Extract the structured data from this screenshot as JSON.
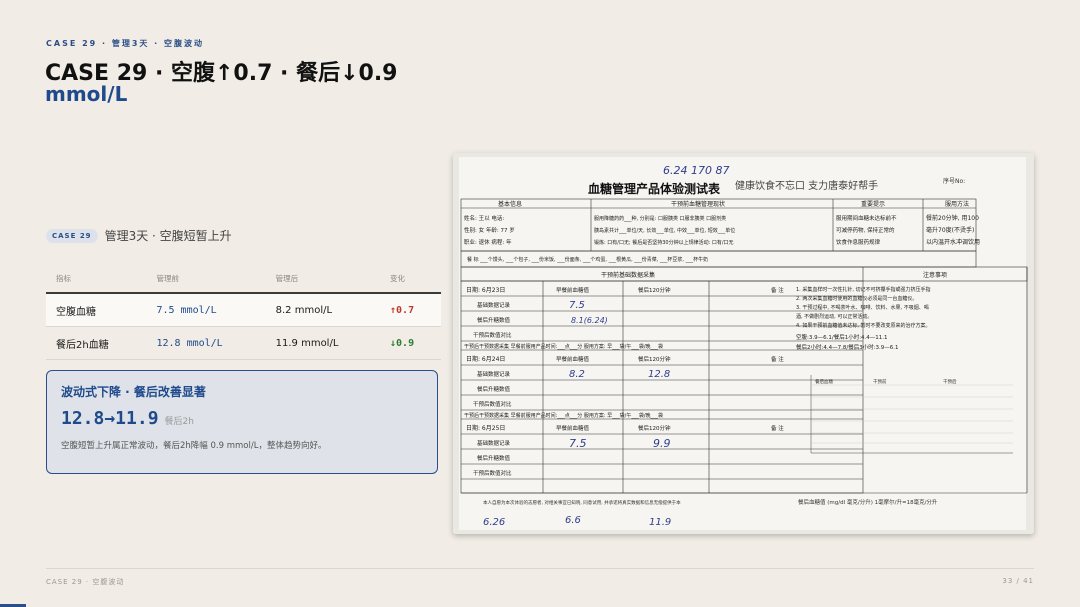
{
  "header": {
    "kicker": "CASE 29 · 管理3天 · 空腹波动",
    "title_line1": "CASE 29 · 空腹↑0.7 · 餐后↓0.9",
    "title_line2": "mmol/L"
  },
  "case_tag": {
    "badge": "CASE 29",
    "subtitle": "管理3天 · 空腹短暂上升"
  },
  "table": {
    "headers": [
      "指标",
      "管理前",
      "管理后",
      "变化"
    ],
    "rows": [
      {
        "metric": "空腹血糖",
        "before": "7.5 mmol/L",
        "after": "8.2 mmol/L",
        "change": "↑0.7"
      },
      {
        "metric": "餐后2h血糖",
        "before": "12.8 mmol/L",
        "after": "11.9 mmol/L",
        "change": "↓0.9"
      }
    ]
  },
  "callout": {
    "heading": "波动式下降 · 餐后改善显著",
    "big_value": "12.8→11.9",
    "big_note": "餐后2h",
    "description": "空腹短暂上升属正常波动，餐后2h降幅 0.9 mmol/L，整体趋势向好。"
  },
  "form": {
    "top_note": "6.24   170   87",
    "title": "血糖管理产品体验测试表",
    "slogan": "健康饮食不忘口 支力唐泰好帮手",
    "serial": "序号No:",
    "col_basic": "基本信息",
    "col_status": "干预前血糖管理现状",
    "col_tips": "重要提示",
    "col_usage": "服用方法",
    "basic_lines": [
      "姓名: 王以   电话:",
      "性别: 女    年龄: 77 岁",
      "职业: 退休    病程:      年"
    ],
    "status_lines": [
      "服用降糖药药___种, 分别是: 口服胰类 口服非胰类 口服剂类",
      "胰岛素共计___单位/天, 长效___单位, 中效___单位, 短效___单位",
      "锻炼: 口有/口无; 餐后是否坚持30分钟以上规律活动: 口有/口无"
    ],
    "tips_lines": [
      "服用期间血糖未达标前不",
      "可减停药物, 保持正常的",
      "饮食作息服药规律"
    ],
    "usage_lines": [
      "餐前20分钟, 用100",
      "毫升70度(不烫手)",
      "以内温开水冲调饮用"
    ],
    "meal_row": "餐  标   ___个馒头, ___个包子, ___份米饭, ___份面条, ___个鸡蛋, ___根黄瓜, ___份青菜, ___杯豆浆, ___杯牛奶",
    "section_baseline": "干预前基础数据采集",
    "section_notes": "注意事项",
    "day1_date": "日期: 6月23日",
    "col_fasting": "早餐前血糖值",
    "col_post": "餐后120分钟",
    "col_remark": "备  注",
    "row_base": "基础数据记录",
    "row_post_up": "餐后升糖数值",
    "row_compare": "干预后数值对比",
    "row_collect1": "干预后干预数据采集   早餐前服用产品时间:___点___分   服用方案: 早___袋/午___袋/晚___袋",
    "day2_date": "日期: 6月24日",
    "row_collect2": "干预后干预数据采集   早餐前服用产品时间:___点___分   服用方案: 早___袋/午___袋/晚___袋",
    "day3_date": "日期: 6月25日",
    "v_day1_fasting": "7.5",
    "v_day1_post": "8.1(6.24)",
    "v_day2_fasting": "8.2",
    "v_day2_post": "12.8",
    "v_day3_fasting": "7.5",
    "v_day3_post": "9.9",
    "notes_lines": [
      "1. 采集血样时一次性扎针, 切记不可挤攥手指或强力挤压手指",
      "2. 两次采集血糖时使用的血糖仪必须是同一台血糖仪。",
      "3. 干预过程中, 不喝茶叶水、咖啡、饮料、水果, 不吸烟、喝",
      "   酒, 不做剧烈运动, 可以正常活动。",
      "4. 如果干预前血糖值未达标, 暂时不要改变原来的治疗方案。",
      "空腹:3.9—6.1/餐后1小时:4.4—11.1",
      "餐后2小时:4.4—7.8/餐后3小时:3.9—6.1"
    ],
    "legend_a": "餐后血糖",
    "legend_b": "干预前",
    "legend_c": "干预后",
    "footer_left": "本人自愿为本次体验的志愿者, 对相关事宜已知晓, 同意试用, 并承诺将真实数据和信息无偿提供于本",
    "footer_right": "餐后血糖值 (mg/dl 毫克/分升) 1毫摩尔/升=18毫克/分升",
    "bottom_a": "6.26",
    "bottom_b": "6.6",
    "bottom_c": "11.9"
  },
  "footer": {
    "left": "CASE 29 · 空腹波动",
    "right": "33 / 41"
  }
}
